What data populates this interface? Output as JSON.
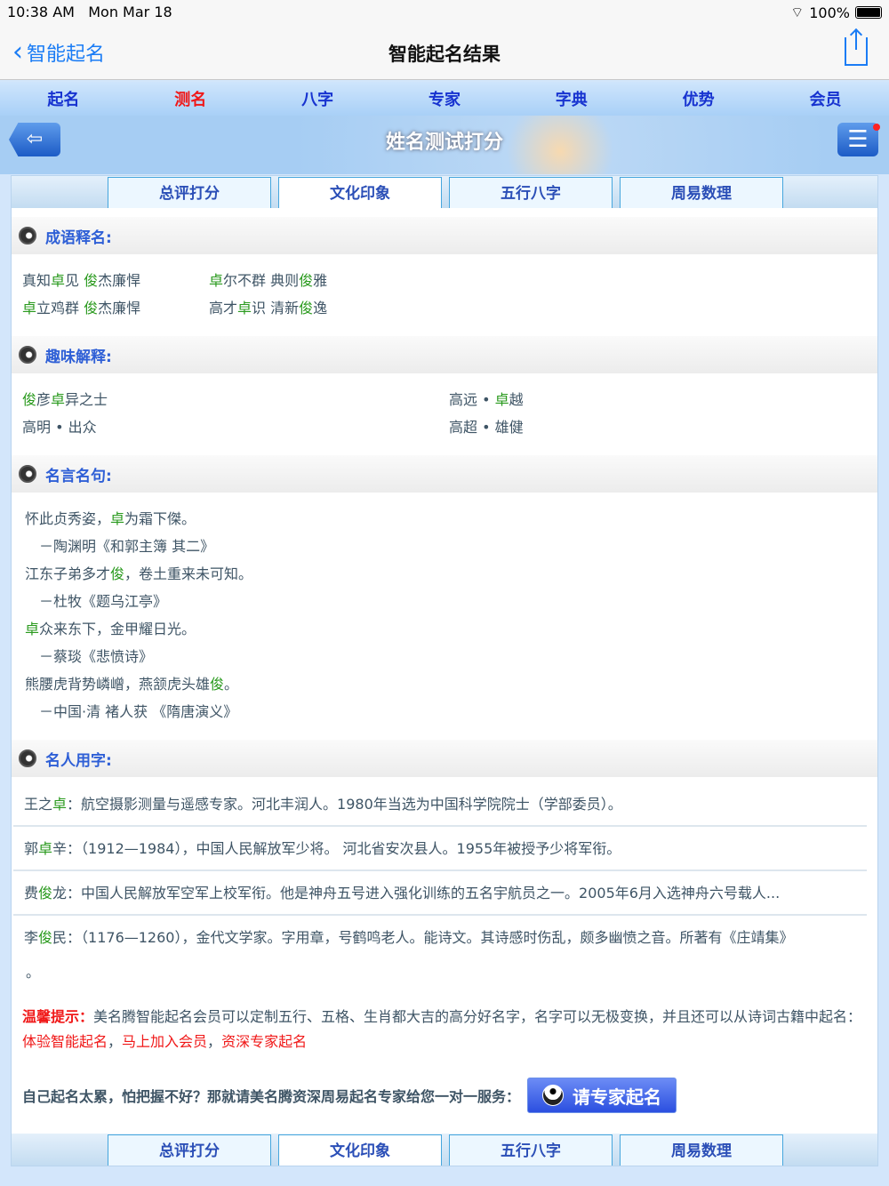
{
  "status": {
    "time": "10:38 AM",
    "date": "Mon Mar 18",
    "battery": "100%",
    "battery_level": 100
  },
  "nav": {
    "back_label": "智能起名",
    "title": "智能起名结果"
  },
  "menu": [
    "起名",
    "测名",
    "八字",
    "专家",
    "字典",
    "优势",
    "会员"
  ],
  "menu_active": 1,
  "banner": {
    "title": "姓名测试打分"
  },
  "tabs": [
    "总评打分",
    "文化印象",
    "五行八字",
    "周易数理"
  ],
  "tabs_active": 1,
  "sections": {
    "idioms": "成语释名:",
    "fun": "趣味解释:",
    "quotes": "名言名句:",
    "famous": "名人用字:"
  },
  "idioms": [
    [
      [
        "真知",
        0
      ],
      [
        "卓",
        1
      ],
      [
        "见 ",
        0
      ],
      [
        "俊",
        1
      ],
      [
        "杰廉悍",
        0
      ]
    ],
    [
      [
        "卓",
        1
      ],
      [
        "尔不群 典则",
        0
      ],
      [
        "俊",
        1
      ],
      [
        "雅",
        0
      ]
    ],
    [
      [
        "卓",
        1
      ],
      [
        "立鸡群 ",
        0
      ],
      [
        "俊",
        1
      ],
      [
        "杰廉悍",
        0
      ]
    ],
    [
      [
        "高才",
        0
      ],
      [
        "卓",
        1
      ],
      [
        "识 清新",
        0
      ],
      [
        "俊",
        1
      ],
      [
        "逸",
        0
      ]
    ]
  ],
  "fun": [
    [
      [
        "俊",
        1
      ],
      [
        "彦",
        0
      ],
      [
        "卓",
        1
      ],
      [
        "异之士",
        0
      ]
    ],
    [
      [
        "高远 • ",
        0
      ],
      [
        "卓",
        1
      ],
      [
        "越",
        0
      ]
    ],
    [
      [
        "高明 • 出众",
        0
      ]
    ],
    [
      [
        "高超 • 雄健",
        0
      ]
    ]
  ],
  "quotes": [
    {
      "text": [
        [
          "怀此贞秀姿，",
          0
        ],
        [
          "卓",
          1
        ],
        [
          "为霜下傑。",
          0
        ]
      ],
      "source": "－陶渊明《和郭主簿 其二》"
    },
    {
      "text": [
        [
          "江东子弟多才",
          0
        ],
        [
          "俊",
          1
        ],
        [
          "，卷土重来未可知。",
          0
        ]
      ],
      "source": "－杜牧《题乌江亭》"
    },
    {
      "text": [
        [
          "卓",
          1
        ],
        [
          "众来东下，金甲耀日光。",
          0
        ]
      ],
      "source": "－蔡琰《悲愤诗》"
    },
    {
      "text": [
        [
          "熊腰虎背势嶙嶒，燕颔虎头雄",
          0
        ],
        [
          "俊",
          1
        ],
        [
          "。",
          0
        ]
      ],
      "source": "－中国·清 褚人获 《隋唐演义》"
    }
  ],
  "famous": [
    [
      [
        "王之",
        0
      ],
      [
        "卓",
        1
      ],
      [
        "：航空摄影测量与遥感专家。河北丰润人。1980年当选为中国科学院院士（学部委员）。",
        0
      ]
    ],
    [
      [
        "郭",
        0
      ],
      [
        "卓",
        1
      ],
      [
        "辛：（1912—1984），中国人民解放军少将。 河北省安次县人。1955年被授予少将军衔。",
        0
      ]
    ],
    [
      [
        "费",
        0
      ],
      [
        "俊",
        1
      ],
      [
        "龙：中国人民解放军空军上校军衔。他是神舟五号进入强化训练的五名宇航员之一。2005年6月入选神舟六号载人...",
        0
      ]
    ],
    [
      [
        "李",
        0
      ],
      [
        "俊",
        1
      ],
      [
        "民：（1176—1260），金代文学家。字用章，号鹤鸣老人。能诗文。其诗感时伤乱，颇多幽愤之音。所著有《庄靖集》",
        0
      ]
    ]
  ],
  "famous_tail": "。",
  "tip": {
    "label": "温馨提示：",
    "text": "美名腾智能起名会员可以定制五行、五格、生肖都大吉的高分好名字，名字可以无极变换，并且还可以从诗词古籍中起名：",
    "links": [
      "体验智能起名",
      "马上加入会员",
      "资深专家起名"
    ],
    "sep": "，"
  },
  "expert": {
    "text": "自己起名太累，怕把握不好？那就请美名腾资深周易起名专家给您一对一服务：",
    "button": "请专家起名"
  }
}
